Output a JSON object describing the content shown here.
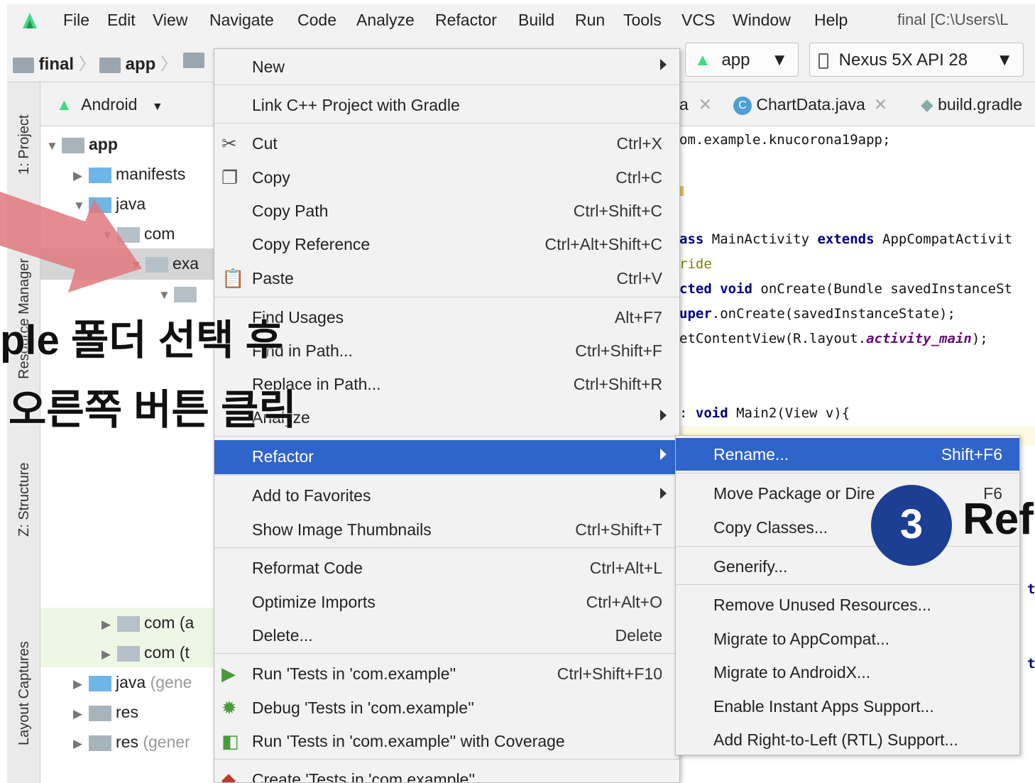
{
  "menubar": {
    "items": [
      "File",
      "Edit",
      "View",
      "Navigate",
      "Code",
      "Analyze",
      "Refactor",
      "Build",
      "Run",
      "Tools",
      "VCS",
      "Window",
      "Help"
    ],
    "window_title": "final [C:\\Users\\L"
  },
  "navbar": {
    "crumbs": [
      "final",
      "app"
    ],
    "run_config": "app",
    "device": "Nexus 5X API 28"
  },
  "left_tabs": {
    "project": "1: Project",
    "resource": "Resource Manager",
    "structure": "Z: Structure",
    "captures": "Layout Captures"
  },
  "project": {
    "view_mode": "Android",
    "tree": [
      {
        "label": "app",
        "bold": true
      },
      {
        "label": "manifests"
      },
      {
        "label": "java"
      },
      {
        "label": "com"
      },
      {
        "label": "exa"
      },
      {
        "label": ""
      },
      {
        "label": "com (a"
      },
      {
        "label": "com (t"
      },
      {
        "label": "java",
        "suffix": "(gene"
      },
      {
        "label": "res"
      },
      {
        "label": "res",
        "suffix": "(gener"
      }
    ]
  },
  "editor": {
    "tabs": [
      "a",
      "ChartData.java",
      "build.gradle"
    ],
    "lines": [
      "om.example.knucorona19app;",
      "ass MainActivity extends AppCompatActivit",
      "ride",
      "cted void onCreate(Bundle savedInstanceSt",
      "uper.onCreate(savedInstanceState);",
      "etContentView(R.layout.activity_main);",
      ": void Main2(View v){",
      "tl",
      "tl"
    ]
  },
  "context_menu": {
    "items": [
      {
        "label": "New",
        "shortcut": "",
        "submenu": true
      },
      {
        "label": "Link C++ Project with Gradle",
        "shortcut": ""
      },
      {
        "label": "Cut",
        "shortcut": "Ctrl+X"
      },
      {
        "label": "Copy",
        "shortcut": "Ctrl+C"
      },
      {
        "label": "Copy Path",
        "shortcut": "Ctrl+Shift+C"
      },
      {
        "label": "Copy Reference",
        "shortcut": "Ctrl+Alt+Shift+C"
      },
      {
        "label": "Paste",
        "shortcut": "Ctrl+V"
      },
      {
        "label": "Find Usages",
        "shortcut": "Alt+F7"
      },
      {
        "label": "Find in Path...",
        "shortcut": "Ctrl+Shift+F"
      },
      {
        "label": "Replace in Path...",
        "shortcut": "Ctrl+Shift+R"
      },
      {
        "label": "Analyze",
        "shortcut": "",
        "submenu": true
      },
      {
        "label": "Refactor",
        "shortcut": "",
        "submenu": true,
        "selected": true
      },
      {
        "label": "Add to Favorites",
        "shortcut": "",
        "submenu": true
      },
      {
        "label": "Show Image Thumbnails",
        "shortcut": "Ctrl+Shift+T"
      },
      {
        "label": "Reformat Code",
        "shortcut": "Ctrl+Alt+L"
      },
      {
        "label": "Optimize Imports",
        "shortcut": "Ctrl+Alt+O"
      },
      {
        "label": "Delete...",
        "shortcut": "Delete"
      },
      {
        "label": "Run 'Tests in 'com.example''",
        "shortcut": "Ctrl+Shift+F10"
      },
      {
        "label": "Debug 'Tests in 'com.example''",
        "shortcut": ""
      },
      {
        "label": "Run 'Tests in 'com.example'' with Coverage",
        "shortcut": ""
      },
      {
        "label": "Create 'Tests in 'com.example''",
        "shortcut": ""
      }
    ]
  },
  "refactor_submenu": {
    "items": [
      {
        "label": "Rename...",
        "shortcut": "Shift+F6",
        "selected": true
      },
      {
        "label": "Move Package or Dire",
        "shortcut": "F6"
      },
      {
        "label": "Copy Classes...",
        "shortcut": ""
      },
      {
        "label": "Generify...",
        "shortcut": ""
      },
      {
        "label": "Remove Unused Resources...",
        "shortcut": ""
      },
      {
        "label": "Migrate to AppCompat...",
        "shortcut": ""
      },
      {
        "label": "Migrate to AndroidX...",
        "shortcut": ""
      },
      {
        "label": "Enable Instant Apps Support...",
        "shortcut": ""
      },
      {
        "label": "Add Right-to-Left (RTL) Support...",
        "shortcut": ""
      }
    ]
  },
  "annotations": {
    "caption_line1": "ple 폴더 선택 후",
    "caption_line2": "오른쪽 버튼 클릭",
    "step_number": "3",
    "step_text": "Ref"
  },
  "colors": {
    "selection": "#2f65ca",
    "badge": "#1c3f94",
    "arrow": "#e0787c"
  }
}
